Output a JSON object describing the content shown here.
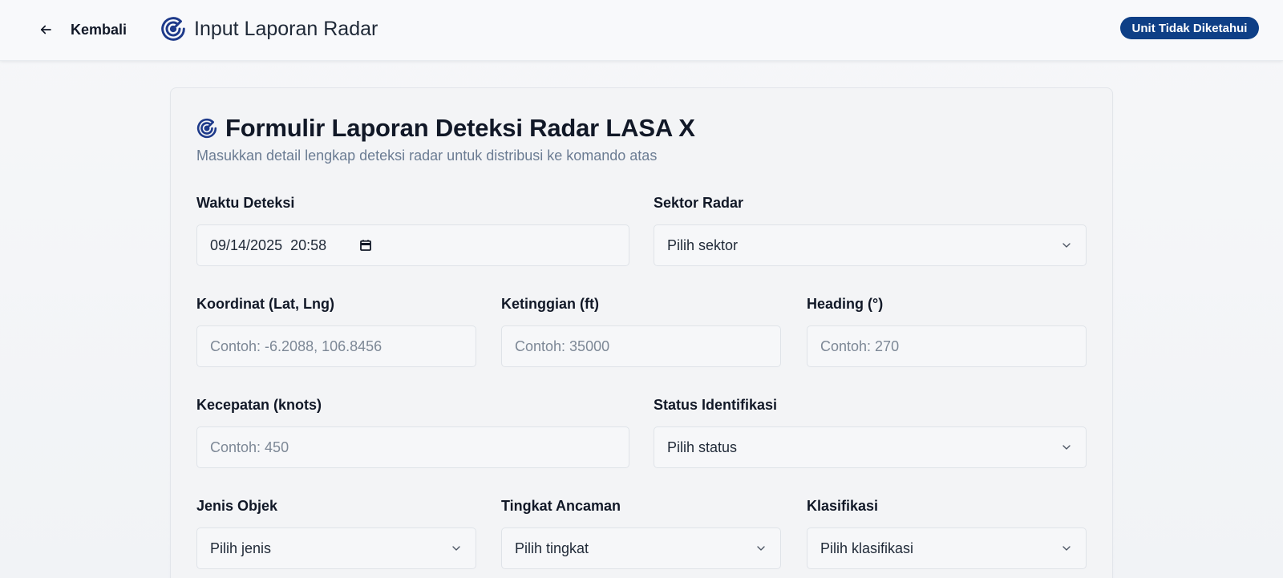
{
  "header": {
    "back_label": "Kembali",
    "title": "Input Laporan Radar",
    "unit_badge": "Unit Tidak Diketahui"
  },
  "form": {
    "title": "Formulir Laporan Deteksi Radar LASA X",
    "subtitle": "Masukkan detail lengkap deteksi radar untuk distribusi ke komando atas",
    "fields": {
      "waktu": {
        "label": "Waktu Deteksi",
        "value": "09/14/2025  20:58"
      },
      "sektor": {
        "label": "Sektor Radar",
        "value": "Pilih sektor"
      },
      "koordinat": {
        "label": "Koordinat (Lat, Lng)",
        "placeholder": "Contoh: -6.2088, 106.8456"
      },
      "ketinggian": {
        "label": "Ketinggian (ft)",
        "placeholder": "Contoh: 35000"
      },
      "heading": {
        "label": "Heading (°)",
        "placeholder": "Contoh: 270"
      },
      "kecepatan": {
        "label": "Kecepatan (knots)",
        "placeholder": "Contoh: 450"
      },
      "status": {
        "label": "Status Identifikasi",
        "value": "Pilih status"
      },
      "jenis": {
        "label": "Jenis Objek",
        "value": "Pilih jenis"
      },
      "ancaman": {
        "label": "Tingkat Ancaman",
        "value": "Pilih tingkat"
      },
      "klasifikasi": {
        "label": "Klasifikasi",
        "value": "Pilih klasifikasi"
      }
    }
  },
  "icons": {
    "back": "arrow-left-icon",
    "radar": "radar-icon",
    "calendar": "calendar-icon",
    "chevron": "chevron-down-icon"
  },
  "colors": {
    "accent": "#0e3f86",
    "radar_icon": "#1e3a8a",
    "text": "#111827",
    "muted": "#6b7c93"
  }
}
